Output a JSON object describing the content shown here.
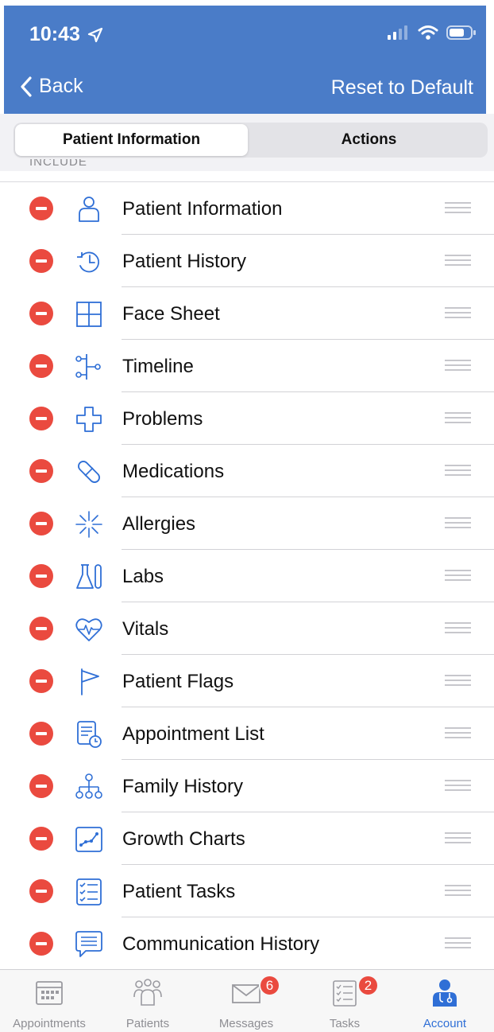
{
  "status_bar": {
    "time": "10:43"
  },
  "nav": {
    "back_label": "Back",
    "reset_label": "Reset to Default"
  },
  "segmented": {
    "tabs": [
      {
        "label": "Patient Information",
        "selected": true
      },
      {
        "label": "Actions",
        "selected": false
      }
    ]
  },
  "section_header": "INCLUDE",
  "items": [
    {
      "label": "Patient Information",
      "icon": "person-icon"
    },
    {
      "label": "Patient History",
      "icon": "history-clock-icon"
    },
    {
      "label": "Face Sheet",
      "icon": "grid-icon"
    },
    {
      "label": "Timeline",
      "icon": "timeline-icon"
    },
    {
      "label": "Problems",
      "icon": "medical-cross-icon"
    },
    {
      "label": "Medications",
      "icon": "pill-icon"
    },
    {
      "label": "Allergies",
      "icon": "allergy-burst-icon"
    },
    {
      "label": "Labs",
      "icon": "lab-flask-icon"
    },
    {
      "label": "Vitals",
      "icon": "heart-pulse-icon"
    },
    {
      "label": "Patient Flags",
      "icon": "flag-icon"
    },
    {
      "label": "Appointment List",
      "icon": "appointment-list-icon"
    },
    {
      "label": "Family History",
      "icon": "family-tree-icon"
    },
    {
      "label": "Growth Charts",
      "icon": "growth-chart-icon"
    },
    {
      "label": "Patient Tasks",
      "icon": "checklist-icon"
    },
    {
      "label": "Communication History",
      "icon": "chat-bubble-icon"
    }
  ],
  "tabbar": {
    "tabs": [
      {
        "label": "Appointments",
        "icon": "calendar-icon",
        "badge": null,
        "active": false
      },
      {
        "label": "Patients",
        "icon": "patients-group-icon",
        "badge": null,
        "active": false
      },
      {
        "label": "Messages",
        "icon": "envelope-icon",
        "badge": "6",
        "active": false
      },
      {
        "label": "Tasks",
        "icon": "tasks-icon",
        "badge": "2",
        "active": false
      },
      {
        "label": "Account",
        "icon": "doctor-icon",
        "badge": null,
        "active": true
      }
    ]
  },
  "colors": {
    "nav_bar": "#4a7cc8",
    "accent": "#2f6fd6",
    "delete": "#ea4a3f",
    "badge": "#ea4a3f"
  }
}
